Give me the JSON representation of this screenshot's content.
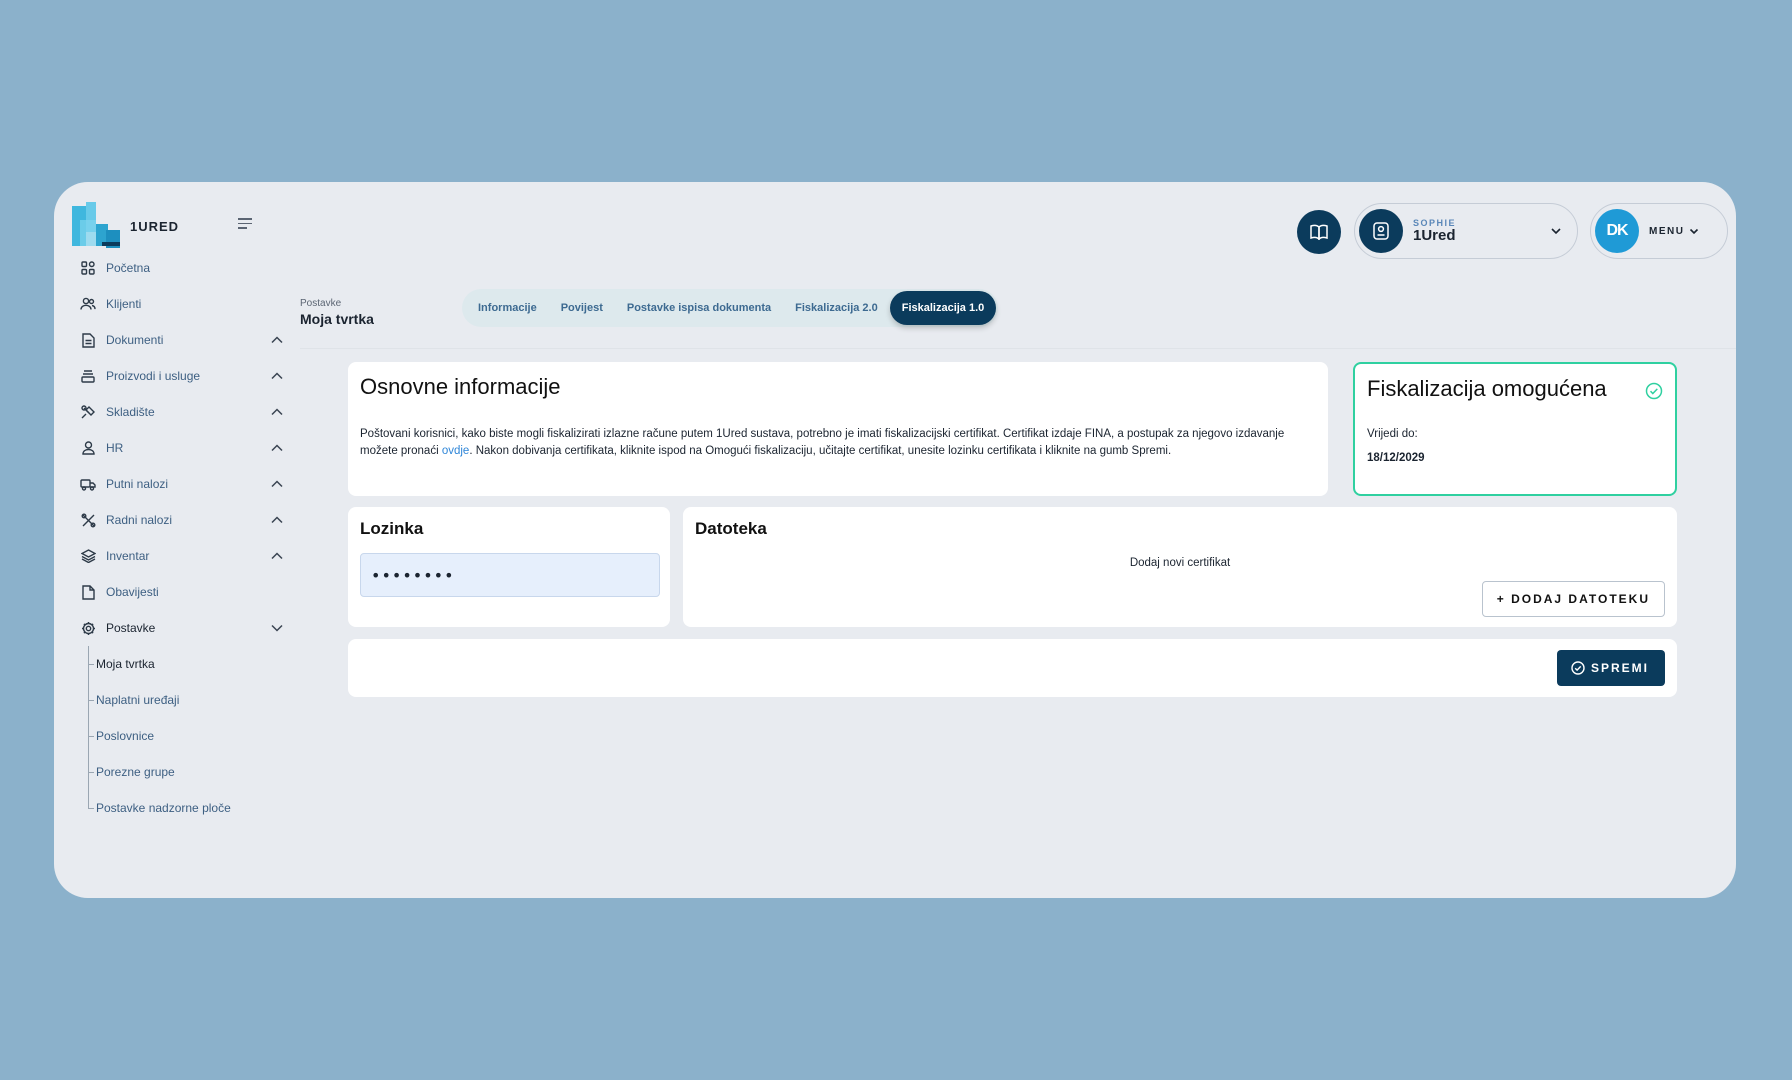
{
  "brand": {
    "name": "1URED"
  },
  "sidebar": {
    "items": [
      {
        "label": "Početna",
        "icon": "dashboard-icon"
      },
      {
        "label": "Klijenti",
        "icon": "users-icon"
      },
      {
        "label": "Dokumenti",
        "icon": "document-icon"
      },
      {
        "label": "Proizvodi i usluge",
        "icon": "stack-icon"
      },
      {
        "label": "Skladište",
        "icon": "warehouse-icon"
      },
      {
        "label": "HR",
        "icon": "user-icon"
      },
      {
        "label": "Putni nalozi",
        "icon": "truck-icon"
      },
      {
        "label": "Radni nalozi",
        "icon": "tools-icon"
      },
      {
        "label": "Inventar",
        "icon": "layers-icon"
      },
      {
        "label": "Obavijesti",
        "icon": "file-icon"
      },
      {
        "label": "Postavke",
        "icon": "gear-icon"
      }
    ],
    "settings_sub": [
      "Moja tvrtka",
      "Naplatni uređaji",
      "Poslovnice",
      "Porezne grupe",
      "Postavke nadzorne ploče"
    ]
  },
  "header": {
    "user_role": "SOPHIE",
    "user_name": "1Ured",
    "menu_avatar": "DK",
    "menu_label": "MENU"
  },
  "breadcrumb": {
    "parent": "Postavke",
    "title": "Moja tvrtka"
  },
  "tabs": [
    "Informacije",
    "Povijest",
    "Postavke ispisa dokumenta",
    "Fiskalizacija 2.0",
    "Fiskalizacija 1.0"
  ],
  "info": {
    "title": "Osnovne informacije",
    "text_before_link": "Poštovani korisnici, kako biste mogli fiskalizirati izlazne račune putem 1Ured sustava, potrebno je imati fiskalizacijski certifikat. Certifikat izdaje FINA, a postupak za njegovo izdavanje možete pronaći ",
    "link": "ovdje",
    "text_after_link": ". Nakon dobivanja certifikata, kliknite ispod na Omogući fiskalizaciju, učitajte certifikat, unesite lozinku certifikata i kliknite na gumb Spremi."
  },
  "fiscal": {
    "title": "Fiskalizacija omogućena",
    "valid_label": "Vrijedi do:",
    "valid_date": "18/12/2029",
    "status_color": "#2fd0a0"
  },
  "password": {
    "title": "Lozinka",
    "value": "••••••••"
  },
  "file": {
    "title": "Datoteka",
    "hint": "Dodaj novi certifikat",
    "button": "+ DODAJ DATOTEKU"
  },
  "save": {
    "button": "SPREMI"
  },
  "colors": {
    "primary": "#0b3b5c",
    "accent": "#1f9ad6",
    "success": "#2fd0a0"
  }
}
